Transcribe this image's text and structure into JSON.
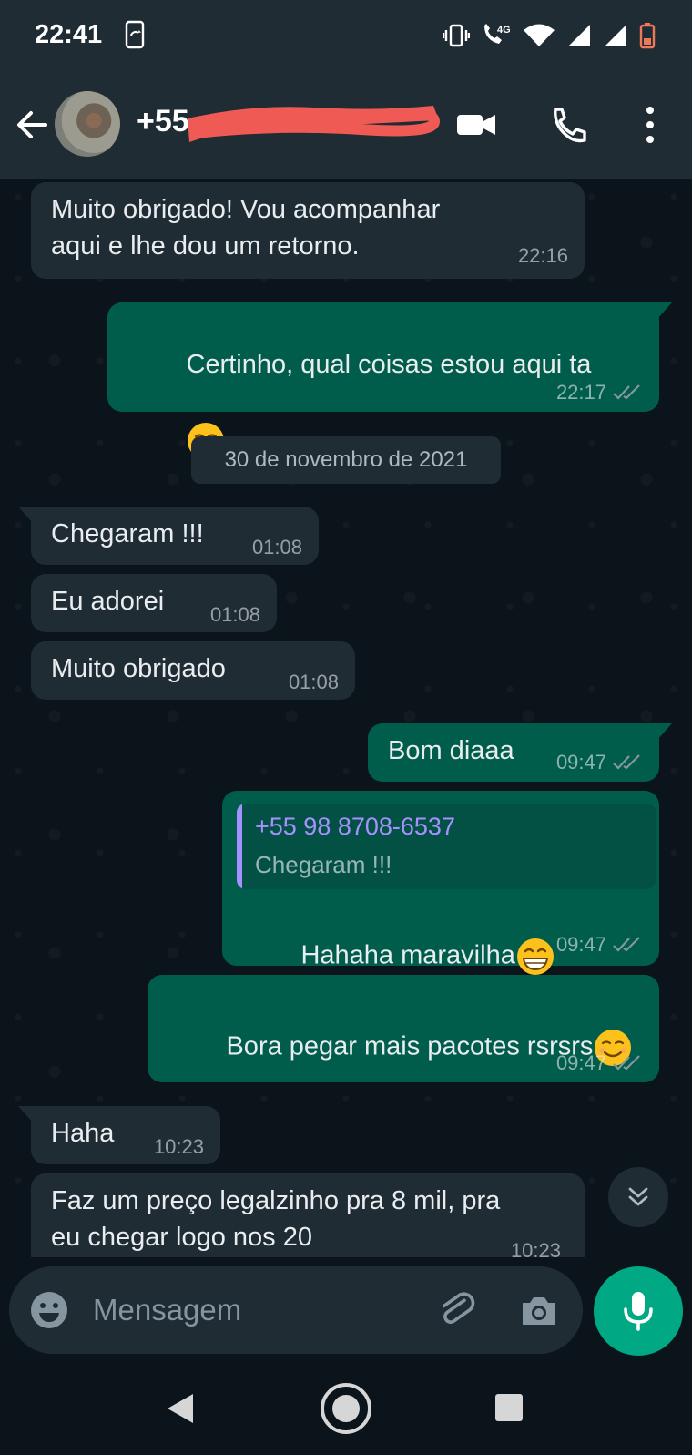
{
  "status_bar": {
    "time": "22:41",
    "network_label": "4G"
  },
  "header": {
    "contact_name": "+55"
  },
  "chat": {
    "date_separator": "30 de novembro de 2021",
    "messages": [
      {
        "dir": "in",
        "text": "Muito obrigado! Vou acompanhar\naqui e lhe dou um retorno.",
        "time": "22:16"
      },
      {
        "dir": "out",
        "text": "Certinho, qual coisas estou aqui ta",
        "emoji": "smiling-face-emoji",
        "time": "22:17",
        "status": "read"
      },
      {
        "dir": "in",
        "text": "Chegaram !!!",
        "time": "01:08"
      },
      {
        "dir": "in",
        "text": "Eu adorei",
        "time": "01:08"
      },
      {
        "dir": "in",
        "text": "Muito obrigado",
        "time": "01:08"
      },
      {
        "dir": "out",
        "text": "Bom diaaa",
        "time": "09:47",
        "status": "read"
      },
      {
        "dir": "out",
        "text": "Hahaha maravilha",
        "emoji": "grinning-face-emoji",
        "time": "09:47",
        "status": "read",
        "quote": {
          "author": "+55 98 8708-6537",
          "text": "Chegaram !!!"
        }
      },
      {
        "dir": "out",
        "text": "Bora pegar mais pacotes rsrsrs",
        "emoji": "smiling-face-emoji",
        "time": "09:47",
        "status": "read"
      },
      {
        "dir": "in",
        "text": "Haha",
        "time": "10:23"
      },
      {
        "dir": "in",
        "text": "Faz um preço legalzinho pra 8 mil, pra\neu chegar logo nos 20",
        "time": "10:23"
      }
    ]
  },
  "composer": {
    "placeholder": "Mensagem"
  },
  "colors": {
    "header_bg": "#1f2c34",
    "chat_bg": "#0b141a",
    "incoming_bubble": "#1f2c34",
    "outgoing_bubble": "#005c4b",
    "accent_green": "#00a884",
    "quote_author": "#a791ff",
    "redaction": "#f05a55"
  },
  "icons": [
    "back-arrow-icon",
    "video-call-icon",
    "phone-icon",
    "more-vert-icon",
    "emoji-icon",
    "attach-icon",
    "camera-icon",
    "mic-icon",
    "chevron-double-down-icon",
    "read-ticks-icon"
  ]
}
